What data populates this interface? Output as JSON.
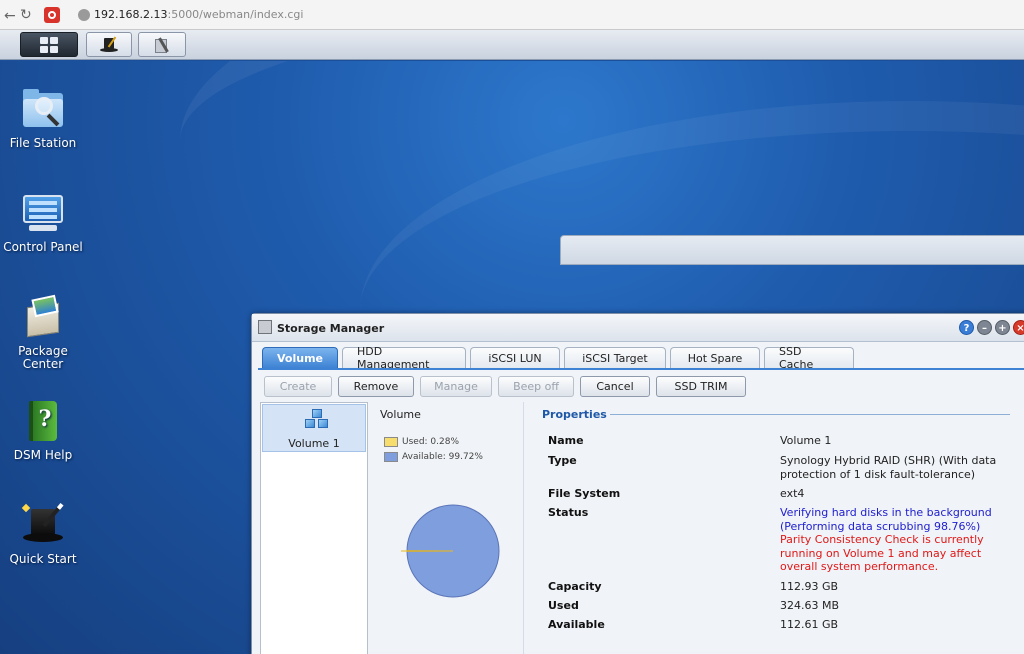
{
  "browser": {
    "url_host": "192.168.2.13",
    "url_path": ":5000/webman/index.cgi"
  },
  "desktop_icons": [
    {
      "label": "File Station"
    },
    {
      "label": "Control Panel"
    },
    {
      "label": "Package Center"
    },
    {
      "label": "DSM Help"
    },
    {
      "label": "Quick Start"
    }
  ],
  "window": {
    "title": "Storage Manager",
    "controls": {
      "help": "?",
      "min": "–",
      "max": "+",
      "close": "×"
    },
    "tabs": [
      "Volume",
      "HDD Management",
      "iSCSI LUN",
      "iSCSI Target",
      "Hot Spare",
      "SSD Cache"
    ],
    "active_tab": "Volume",
    "toolbar": [
      {
        "label": "Create",
        "enabled": false
      },
      {
        "label": "Remove",
        "enabled": true
      },
      {
        "label": "Manage",
        "enabled": false
      },
      {
        "label": "Beep off",
        "enabled": false
      },
      {
        "label": "Cancel",
        "enabled": true
      },
      {
        "label": "SSD TRIM",
        "enabled": true
      }
    ],
    "volume_list": [
      {
        "label": "Volume 1",
        "selected": true
      }
    ],
    "chart": {
      "title": "Volume",
      "used_label": "Used: 0.28%",
      "available_label": "Available: 99.72%",
      "used_pct": 0.28,
      "available_pct": 99.72,
      "used_color": "#f7dd6e",
      "available_color": "#7f9ede"
    },
    "properties": {
      "title": "Properties",
      "name_label": "Name",
      "name_value": "Volume 1",
      "type_label": "Type",
      "type_value": "Synology Hybrid RAID (SHR) (With data protection of 1 disk fault-tolerance)",
      "fs_label": "File System",
      "fs_value": "ext4",
      "status_label": "Status",
      "status_line1": "Verifying hard disks in the background",
      "status_line2": "Performing data scrubbing 98.76%",
      "status_warning": "Parity Consistency Check is currently running on Volume 1 and may affect overall system performance.",
      "capacity_label": "Capacity",
      "capacity_value": "112.93 GB",
      "used_label": "Used",
      "used_value": "324.63 MB",
      "available_label": "Available",
      "available_value": "112.61 GB"
    }
  }
}
